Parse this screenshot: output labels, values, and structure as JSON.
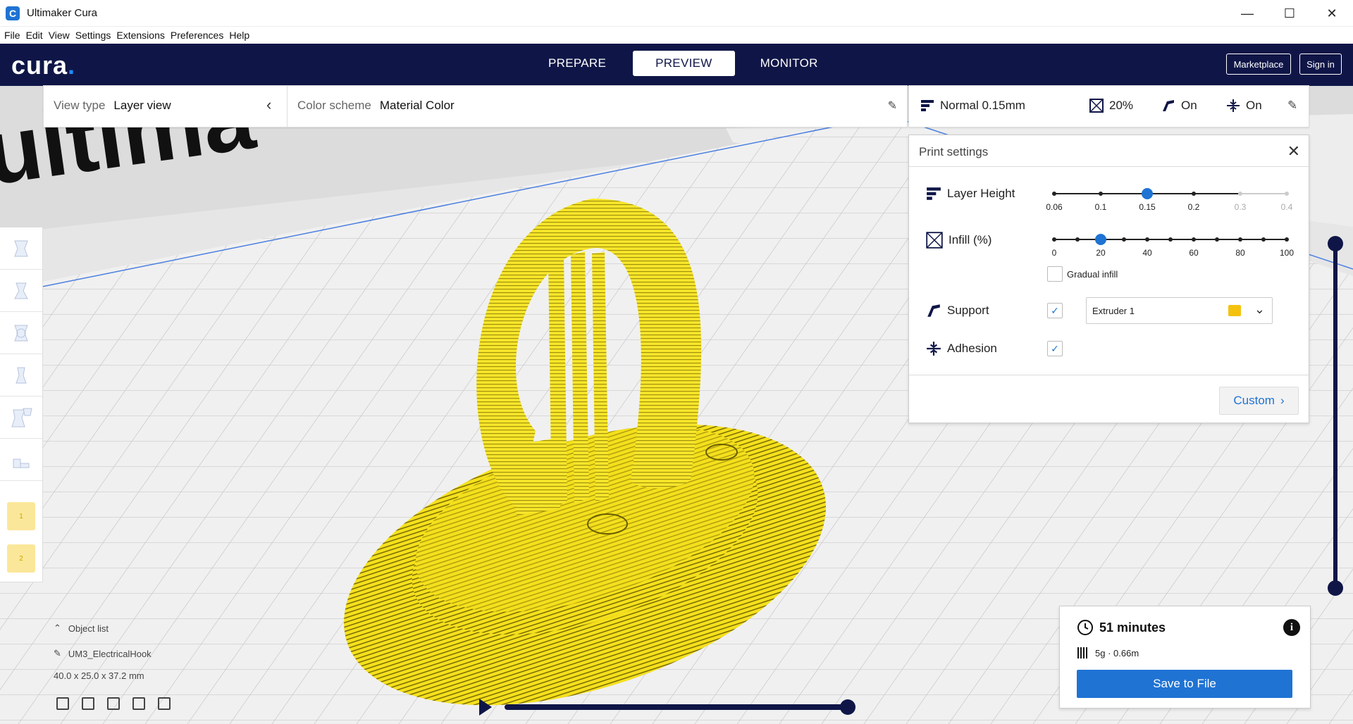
{
  "window": {
    "title": "Ultimaker Cura",
    "minimize": "—",
    "maximize": "☐",
    "close": "✕"
  },
  "menu": [
    "File",
    "Edit",
    "View",
    "Settings",
    "Extensions",
    "Preferences",
    "Help"
  ],
  "header": {
    "logo": "cura",
    "stages": [
      "PREPARE",
      "PREVIEW",
      "MONITOR"
    ],
    "active_stage": "PREVIEW",
    "marketplace": "Marketplace",
    "sign_in": "Sign in"
  },
  "view_options": {
    "view_type_label": "View type",
    "view_type_value": "Layer view",
    "color_scheme_label": "Color scheme",
    "color_scheme_value": "Material Color"
  },
  "print_summary": {
    "profile": "Normal 0.15mm",
    "infill": "20%",
    "support": "On",
    "adhesion": "On"
  },
  "print_settings": {
    "title": "Print settings",
    "layer_height": {
      "label": "Layer Height",
      "ticks": [
        "0.06",
        "0.1",
        "0.15",
        "0.2",
        "0.3",
        "0.4"
      ],
      "selected": "0.15",
      "disabled_ticks": [
        "0.3",
        "0.4"
      ]
    },
    "infill": {
      "label": "Infill (%)",
      "ticks": [
        "0",
        "20",
        "40",
        "60",
        "80",
        "100"
      ],
      "minor_ticks": 11,
      "value": 20
    },
    "gradual_infill": {
      "label": "Gradual infill",
      "checked": false
    },
    "support": {
      "label": "Support",
      "checked": true,
      "extruder": "Extruder 1",
      "extruder_color": "#f4c20d"
    },
    "adhesion": {
      "label": "Adhesion",
      "checked": true
    },
    "custom_button": "Custom"
  },
  "left_toolbar": {
    "tools": [
      "move-tool",
      "scale-tool",
      "rotate-tool",
      "mirror-tool",
      "per-model-settings-tool",
      "support-blocker-tool"
    ],
    "extruders": [
      "1",
      "2"
    ]
  },
  "object_list": {
    "header": "Object list",
    "object_name": "UM3_ElectricalHook",
    "dimensions": "40.0 x 25.0 x 37.2 mm"
  },
  "output": {
    "print_time": "51 minutes",
    "material": "5g · 0.66m",
    "save_button": "Save to File"
  },
  "colors": {
    "header_bg": "#0f1647",
    "accent": "#1f73d3",
    "model_yellow": "#f4e01c"
  }
}
